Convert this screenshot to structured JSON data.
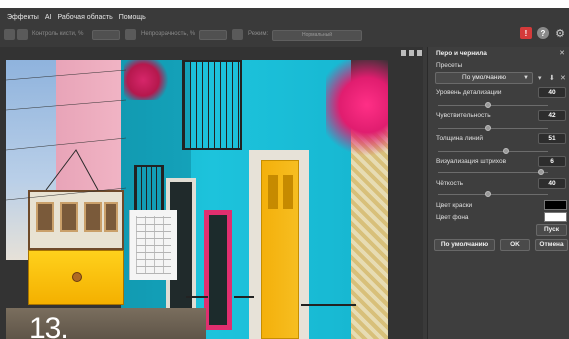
{
  "menu": [
    "Эффекты",
    "AI",
    "Рабочая область",
    "Помощь"
  ],
  "toolbar": {
    "brush_size_label": "Контроль кисти, %",
    "transparency_label": "Непрозрачность, %",
    "mode_label": "Режим:",
    "mode_value": "Нормальный"
  },
  "title_icons": {
    "alert": "!",
    "help": "?",
    "settings": "⚙"
  },
  "panel": {
    "title": "Перо и чернила",
    "close": "✕",
    "presets_label": "Пресеты",
    "preset_value": "По умолчанию",
    "preset_arrow": "▼",
    "sliders": [
      {
        "label": "Уровень детализации",
        "value": "40",
        "fraction": 0.45
      },
      {
        "label": "Чувствительность",
        "value": "42",
        "fraction": 0.45
      },
      {
        "label": "Толщина линий",
        "value": "51",
        "fraction": 0.62
      },
      {
        "label": "Визуализация штрихов",
        "value": "6",
        "fraction": 0.94
      },
      {
        "label": "Чёткость",
        "value": "40",
        "fraction": 0.45
      }
    ],
    "ink_color_label": "Цвет краски",
    "ink_color": "#000000",
    "bg_color_label": "Цвет фона",
    "bg_color": "#ffffff",
    "run_button": "Пуск",
    "default_button": "По умолчанию",
    "ok_button": "OK",
    "cancel_button": "Отмена"
  },
  "overlay_number": "13."
}
